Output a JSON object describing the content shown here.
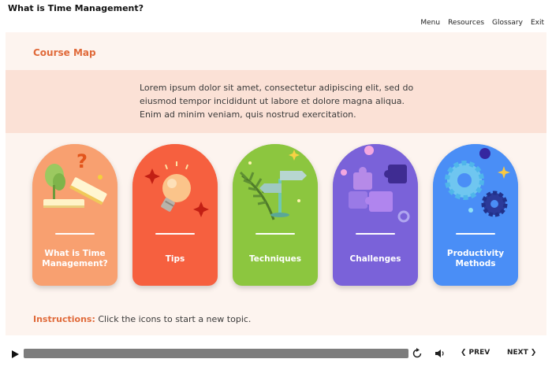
{
  "header": {
    "title": "What is Time Management?",
    "nav": [
      "Menu",
      "Resources",
      "Glossary",
      "Exit"
    ]
  },
  "slide": {
    "heading": "Course Map",
    "intro": "Lorem ipsum dolor sit amet, consectetur adipiscing elit, sed do eiusmod tempor incididunt ut labore et dolore magna aliqua. Enim ad minim veniam, quis nostrud exercitation.",
    "cards": [
      {
        "label": "What is Time Management?",
        "icon": "books-plant-icon",
        "color": "#f8a070"
      },
      {
        "label": "Tips",
        "icon": "lightbulb-icon",
        "color": "#f6603f"
      },
      {
        "label": "Techniques",
        "icon": "signpost-icon",
        "color": "#8cc63f"
      },
      {
        "label": "Challenges",
        "icon": "puzzle-icon",
        "color": "#7a62d9"
      },
      {
        "label": "Productivity Methods",
        "icon": "gears-icon",
        "color": "#4a8ef6"
      }
    ],
    "instructions_key": "Instructions:",
    "instructions_text": " Click the icons to start a new topic."
  },
  "controls": {
    "prev_label": "PREV",
    "next_label": "NEXT",
    "progress": 1.0
  },
  "colors": {
    "accent": "#e06a3a",
    "slide_bg": "#fdf4ef",
    "band_bg": "#fbe1d6"
  }
}
